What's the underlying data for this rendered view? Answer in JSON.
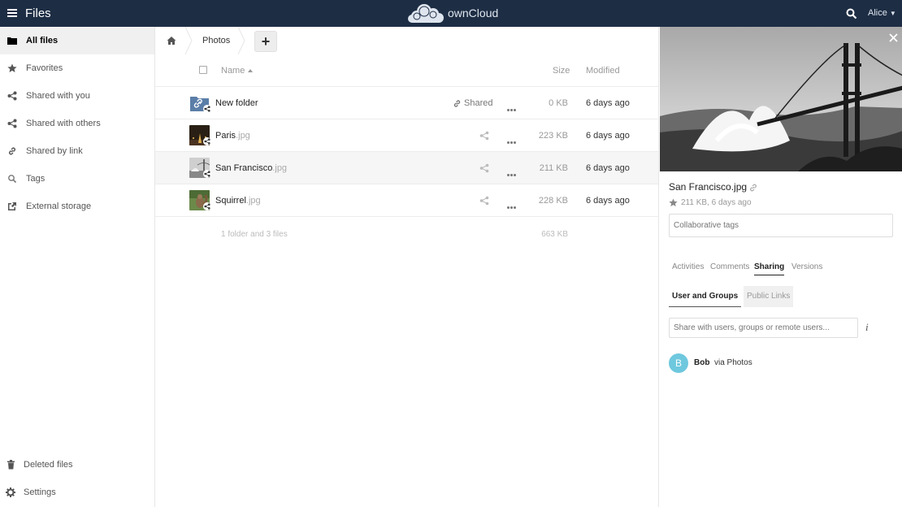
{
  "header": {
    "app_title": "Files",
    "brand_name": "ownCloud",
    "user_name": "Alice",
    "background_color": "#1d2d44"
  },
  "sidebar": {
    "items": [
      {
        "label": "All files",
        "icon": "folder-icon",
        "active": true
      },
      {
        "label": "Favorites",
        "icon": "star-icon"
      },
      {
        "label": "Shared with you",
        "icon": "share-icon"
      },
      {
        "label": "Shared with others",
        "icon": "share-icon"
      },
      {
        "label": "Shared by link",
        "icon": "link-icon"
      },
      {
        "label": "Tags",
        "icon": "tag-search-icon"
      },
      {
        "label": "External storage",
        "icon": "external-link-icon"
      }
    ],
    "bottom": [
      {
        "label": "Deleted files",
        "icon": "trash-icon"
      },
      {
        "label": "Settings",
        "icon": "gear-icon"
      }
    ]
  },
  "breadcrumb": {
    "current": "Photos",
    "new_label": "+"
  },
  "file_list": {
    "columns": {
      "name": "Name",
      "size": "Size",
      "modified": "Modified"
    },
    "rows": [
      {
        "name": "New folder",
        "ext": "",
        "shared_label": "Shared",
        "size": "0 KB",
        "modified": "6 days ago",
        "type": "folder"
      },
      {
        "name": "Paris",
        "ext": ".jpg",
        "shared_label": "",
        "size": "223 KB",
        "modified": "6 days ago",
        "type": "image"
      },
      {
        "name": "San Francisco",
        "ext": ".jpg",
        "shared_label": "",
        "size": "211 KB",
        "modified": "6 days ago",
        "type": "image",
        "selected": true
      },
      {
        "name": "Squirrel",
        "ext": ".jpg",
        "shared_label": "",
        "size": "228 KB",
        "modified": "6 days ago",
        "type": "image"
      }
    ],
    "summary_text": "1 folder and 3 files",
    "summary_size": "663 KB"
  },
  "details": {
    "filename": "San Francisco.jpg",
    "meta": "211 KB, 6 days ago",
    "tags_placeholder": "Collaborative tags",
    "tabs": [
      "Activities",
      "Comments",
      "Sharing",
      "Versions"
    ],
    "active_tab": "Sharing",
    "subtabs": [
      "User and Groups",
      "Public Links"
    ],
    "share_placeholder": "Share with users, groups or remote users...",
    "info_symbol": "i",
    "sharees": [
      {
        "initial": "B",
        "name": "Bob",
        "via": "via Photos",
        "avatar_color": "#6ec8de"
      }
    ]
  }
}
